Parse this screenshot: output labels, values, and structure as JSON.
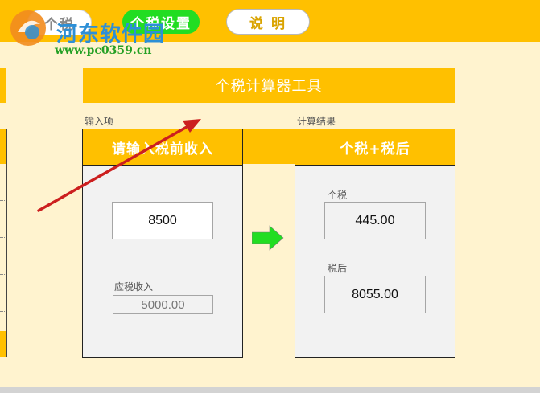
{
  "tabs": {
    "tab1_label": "个税",
    "tab2_label": "个税设置",
    "help_label": "说 明"
  },
  "watermark": {
    "site_name": "河东软件园",
    "url": "www.pc0359.cn"
  },
  "calculator": {
    "title": "个税计算器工具",
    "input_caption": "输入项",
    "output_caption": "计算结果",
    "input_panel_title": "请输入税前收入",
    "output_panel_title": "个税+税后",
    "pretax_income": "8500",
    "taxable_income_label": "应税收入",
    "taxable_income": "5000.00",
    "tax_label": "个税",
    "tax_value": "445.00",
    "after_tax_label": "税后",
    "after_tax_value": "8055.00"
  },
  "colors": {
    "accent": "#ffc000",
    "background": "#fff3cf",
    "go_arrow": "#22dd22",
    "annotation_arrow": "#cc1f1f"
  },
  "icons": {
    "go_arrow": "right-arrow-icon",
    "annotation": "red-pointer-arrow"
  }
}
